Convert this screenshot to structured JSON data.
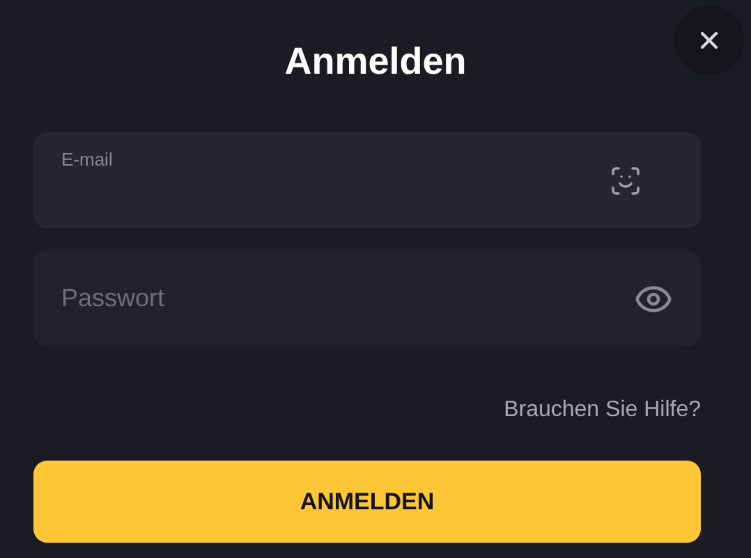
{
  "dialog": {
    "title": "Anmelden"
  },
  "email_field": {
    "label": "E-mail"
  },
  "password_field": {
    "placeholder": "Passwort"
  },
  "help_link": "Brauchen Sie Hilfe?",
  "submit_button": "ANMELDEN"
}
